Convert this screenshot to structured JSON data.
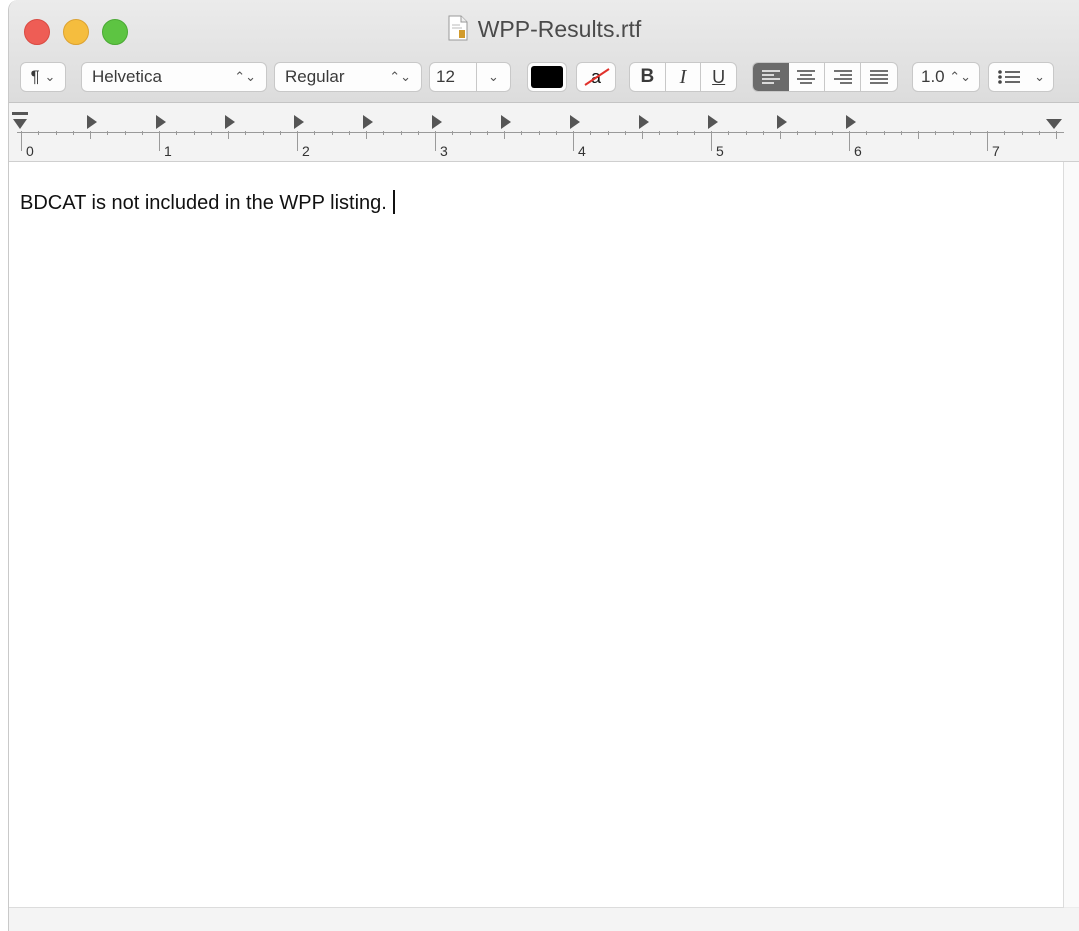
{
  "window": {
    "title": "WPP-Results.rtf"
  },
  "toolbar": {
    "paragraph_style_icon": "¶",
    "font_family": "Helvetica",
    "font_style": "Regular",
    "font_size": "12",
    "italic_label": "I",
    "bold_label": "B",
    "underline_label": "U",
    "highlight_label": "a",
    "line_spacing": "1.0",
    "colors": {
      "text": "#000000",
      "accent_selected": "#6b6b6b"
    }
  },
  "ruler": {
    "numbers": [
      "0",
      "1",
      "2",
      "3",
      "4",
      "5",
      "6",
      "7"
    ]
  },
  "document": {
    "text": "BDCAT is not included in the WPP listing."
  }
}
